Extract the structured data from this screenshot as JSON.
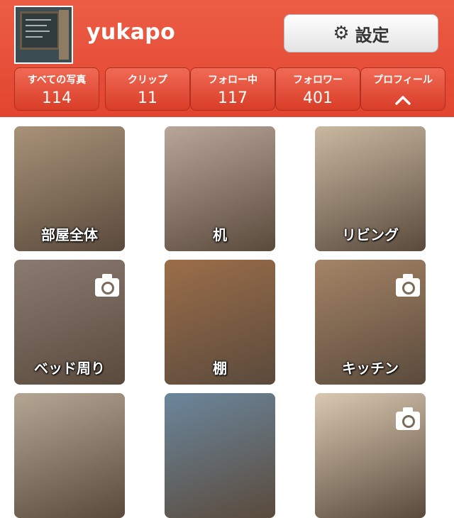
{
  "header": {
    "username": "yukapo",
    "settings_label": "設定",
    "settings_icon": "gear-icon",
    "brand_color": "#e4503a"
  },
  "stats": [
    {
      "label": "すべての写真",
      "value": "114"
    },
    {
      "label": "クリップ",
      "value": "11"
    },
    {
      "label": "フォロー中",
      "value": "117"
    },
    {
      "label": "フォロワー",
      "value": "401"
    },
    {
      "label": "プロフィール",
      "icon": "chevron-up-icon"
    }
  ],
  "tiles": [
    {
      "caption": "部屋全体",
      "color": "#a89278",
      "camera": false
    },
    {
      "caption": "机",
      "color": "#b8a69a",
      "camera": false
    },
    {
      "caption": "リビング",
      "color": "#c9b9a2",
      "camera": false
    },
    {
      "caption": "ベッド周り",
      "color": "#8a7a72",
      "camera": true
    },
    {
      "caption": "棚",
      "color": "#9c6e49",
      "camera": false
    },
    {
      "caption": "キッチン",
      "color": "#a48466",
      "camera": true
    },
    {
      "caption": "",
      "color": "#b5a694",
      "camera": false
    },
    {
      "caption": "",
      "color": "#6b879c",
      "camera": false
    },
    {
      "caption": "",
      "color": "#d9c9b2",
      "camera": true
    }
  ]
}
